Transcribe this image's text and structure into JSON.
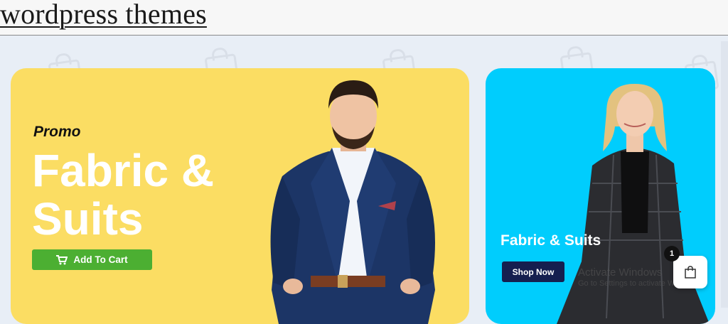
{
  "header": {
    "site_title": "wordpress themes"
  },
  "promo_left": {
    "kicker": "Promo",
    "title": "Fabric & Suits",
    "button_label": "Add To Cart",
    "bg_color": "#fbdd63",
    "button_color": "#4caf32"
  },
  "promo_right": {
    "title": "Fabric & Suits",
    "button_label": "Shop Now",
    "bg_color": "#00cdfd",
    "button_color": "#151f4f"
  },
  "cart": {
    "count": "1"
  },
  "watermark": {
    "line1": "Activate Windows",
    "line2": "Go to Settings to activate Windows."
  },
  "icons": {
    "cart": "shopping-cart-icon",
    "bag": "shopping-bag-icon"
  }
}
